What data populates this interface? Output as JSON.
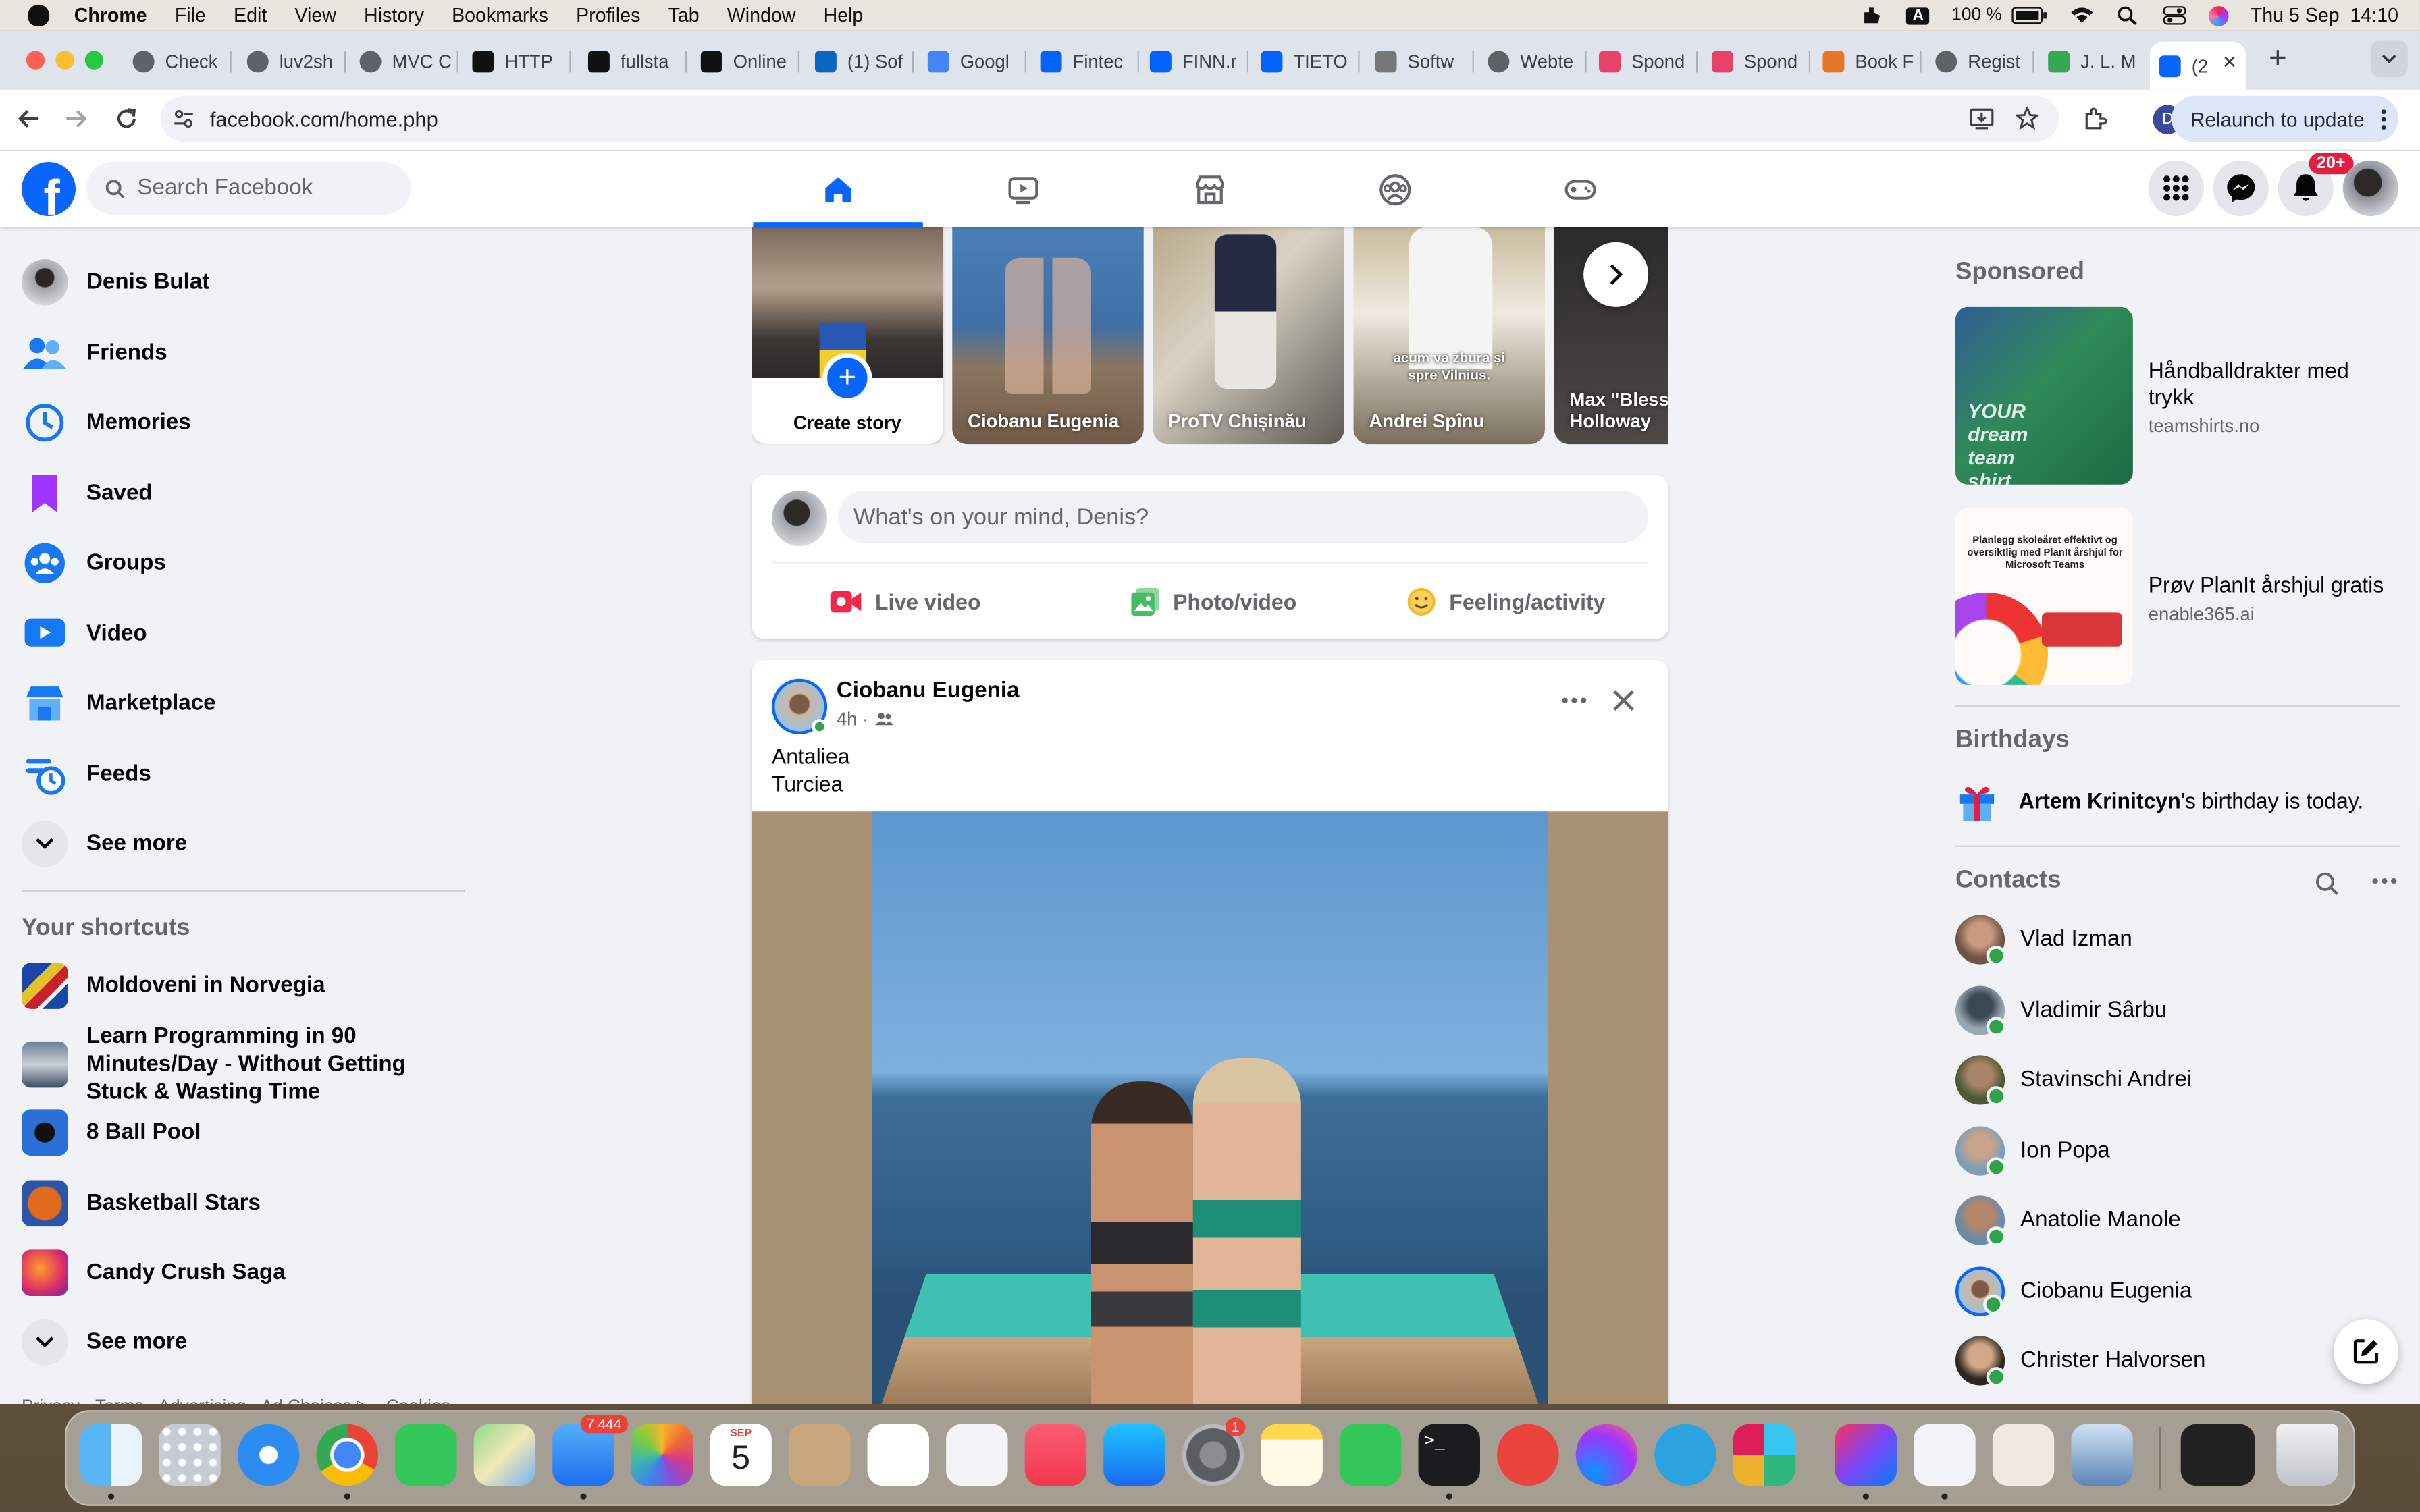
{
  "menubar": {
    "app": "Chrome",
    "items": [
      "File",
      "Edit",
      "View",
      "History",
      "Bookmarks",
      "Profiles",
      "Tab",
      "Window",
      "Help"
    ],
    "input_source": "A",
    "battery": "100 %",
    "datetime": "Thu 5 Sep  14:10"
  },
  "tabs": [
    {
      "label": "Check",
      "icon": "globe-icon"
    },
    {
      "label": "luv2sh",
      "icon": "code-icon"
    },
    {
      "label": "MVC C",
      "icon": "globe-icon"
    },
    {
      "label": "HTTP",
      "icon": "medium-icon"
    },
    {
      "label": "fullsta",
      "icon": "github-icon"
    },
    {
      "label": "Online",
      "icon": "github-icon"
    },
    {
      "label": "(1) Sof",
      "icon": "linkedin-icon"
    },
    {
      "label": "Googl",
      "icon": "translate-icon"
    },
    {
      "label": "Fintec",
      "icon": "finn-icon"
    },
    {
      "label": "FINN.r",
      "icon": "finn-icon"
    },
    {
      "label": "TIETO",
      "icon": "finn-icon"
    },
    {
      "label": "Softw",
      "icon": "wiki-icon"
    },
    {
      "label": "Webte",
      "icon": "globe-icon"
    },
    {
      "label": "Spond",
      "icon": "spond-icon"
    },
    {
      "label": "Spond",
      "icon": "spond-icon"
    },
    {
      "label": "Book F",
      "icon": "book-icon"
    },
    {
      "label": "Regist",
      "icon": "globe-icon"
    },
    {
      "label": "J. L. M",
      "icon": "maps-icon"
    },
    {
      "label": "(2",
      "icon": "facebook-icon"
    }
  ],
  "toolbar": {
    "url": "facebook.com/home.php",
    "profile_initial": "D",
    "relaunch_label": "Relaunch to update"
  },
  "fb": {
    "search_placeholder": "Search Facebook",
    "notif_badge": "20+",
    "left_nav": [
      "Denis Bulat",
      "Friends",
      "Memories",
      "Saved",
      "Groups",
      "Video",
      "Marketplace",
      "Feeds",
      "See more"
    ],
    "shortcuts_title": "Your shortcuts",
    "shortcuts": [
      "Moldoveni in Norvegia",
      "Learn Programming in 90 Minutes/Day - Without Getting Stuck & Wasting Time",
      "8 Ball Pool",
      "Basketball Stars",
      "Candy Crush Saga",
      "See more"
    ],
    "footer": "Privacy · Terms · Advertising · Ad Choices ▷ · Cookies",
    "stories": {
      "create": "Create story",
      "items": [
        "Ciobanu Eugenia",
        "ProTV Chișinău",
        "Andrei Spînu",
        "Max \"Blesse Holloway"
      ],
      "story_caption": "acum va zbura și spre Vilnius."
    },
    "composer": {
      "placeholder": "What's on your mind, Denis?",
      "live": "Live video",
      "photo": "Photo/video",
      "feeling": "Feeling/activity"
    },
    "post": {
      "author": "Ciobanu Eugenia",
      "time": "4h ·",
      "line1": "Antaliea",
      "line2": "Turciea"
    },
    "right": {
      "sponsored": "Sponsored",
      "ads": [
        {
          "title": "Håndballdrakter med trykk",
          "url": "teamshirts.no",
          "img_text": "YOUR dream team shirt."
        },
        {
          "title": "Prøv PlanIt årshjul gratis",
          "url": "enable365.ai",
          "img_text": "Planlegg skoleåret effektivt og oversiktlig med PlanIt årshjul for Microsoft Teams"
        }
      ],
      "birthdays": "Birthdays",
      "birthday_name": "Artem Krinitcyn",
      "birthday_text": "'s birthday is today.",
      "contacts": "Contacts",
      "contact_list": [
        "Vlad Izman",
        "Vladimir Sârbu",
        "Stavinschi Andrei",
        "Ion Popa",
        "Anatolie Manole",
        "Ciobanu Eugenia",
        "Christer Halvorsen"
      ]
    }
  },
  "dock": {
    "mail_badge": "7 444",
    "calendar_month": "SEP",
    "calendar_day": "5",
    "settings_badge": "1"
  }
}
